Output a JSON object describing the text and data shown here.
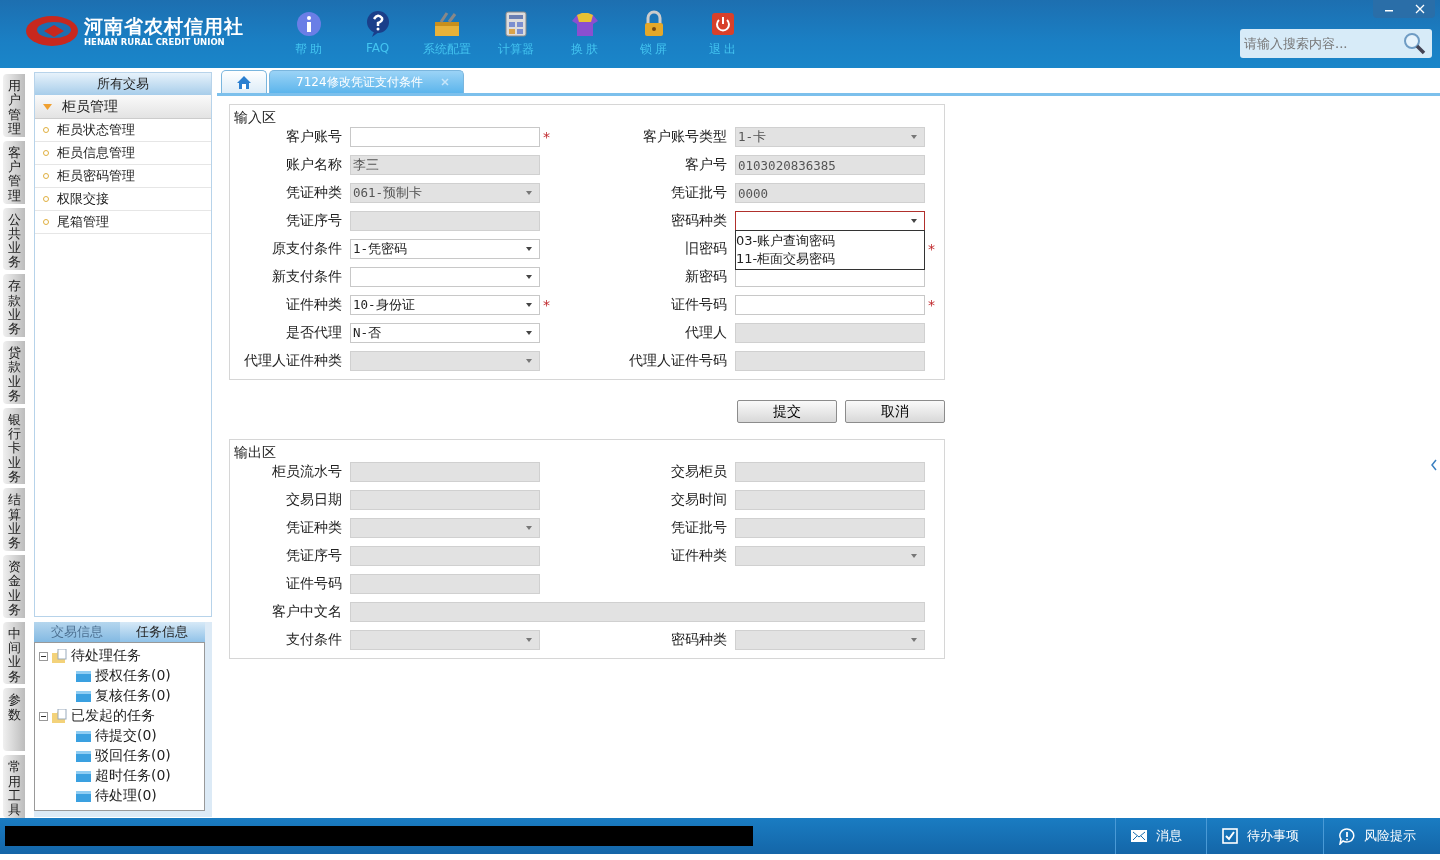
{
  "header": {
    "logo_title": "河南省农村信用社",
    "logo_subtitle": "HENAN RURAL CREDIT UNION",
    "tools": [
      {
        "kind": "help",
        "label": "帮 助"
      },
      {
        "kind": "faq",
        "label": "FAQ"
      },
      {
        "kind": "config",
        "label": "系统配置"
      },
      {
        "kind": "calculator",
        "label": "计算器"
      },
      {
        "kind": "skin",
        "label": "换 肤"
      },
      {
        "kind": "lock",
        "label": "锁 屏"
      },
      {
        "kind": "exit",
        "label": "退 出"
      }
    ],
    "search": {
      "placeholder": "请输入搜索内容..."
    }
  },
  "side_tabs": [
    "用户管理",
    "客户管理",
    "公共业务",
    "存款业务",
    "贷款业务",
    "银行卡业务",
    "结算业务",
    "资金业务",
    "中间业务",
    "参数",
    "常用工具"
  ],
  "sidebar": {
    "title": "所有交易",
    "group": {
      "label": "柜员管理",
      "expanded": true,
      "items": [
        "柜员状态管理",
        "柜员信息管理",
        "柜员密码管理",
        "权限交接",
        "尾箱管理"
      ]
    }
  },
  "task_panel": {
    "tabs": [
      {
        "label": "交易信息",
        "selected": false
      },
      {
        "label": "任务信息",
        "selected": true
      }
    ],
    "tree": [
      {
        "label": "待处理任务",
        "expanded": true,
        "children": [
          {
            "label": "授权任务(0)"
          },
          {
            "label": "复核任务(0)"
          }
        ]
      },
      {
        "label": "已发起的任务",
        "expanded": true,
        "children": [
          {
            "label": "待提交(0)"
          },
          {
            "label": "驳回任务(0)"
          },
          {
            "label": "超时任务(0)"
          },
          {
            "label": "待处理(0)"
          }
        ]
      }
    ]
  },
  "tabs": [
    {
      "kind": "home",
      "selected": false
    },
    {
      "kind": "page",
      "label": "7124修改凭证支付条件",
      "selected": true
    }
  ],
  "input_section": {
    "title": "输入区",
    "fields": [
      {
        "label": "客户账号",
        "kind": "text",
        "disabled": false,
        "mark": "*"
      },
      {
        "label": "客户账号类型",
        "kind": "select",
        "value": "1-卡",
        "disabled": true
      },
      {
        "label": "账户名称",
        "kind": "text",
        "value": "李三",
        "disabled": true
      },
      {
        "label": "客户号",
        "kind": "text",
        "value": "0103020836385",
        "disabled": true
      },
      {
        "label": "凭证种类",
        "kind": "select",
        "value": "061-预制卡",
        "disabled": true
      },
      {
        "label": "凭证批号",
        "kind": "text",
        "value": "0000",
        "disabled": true
      },
      {
        "label": "凭证序号",
        "kind": "text",
        "disabled": true
      },
      {
        "label": "密码种类",
        "kind": "select",
        "disabled": false,
        "expanded": true,
        "options": [
          "03-账户查询密码",
          "11-柜面交易密码"
        ]
      },
      {
        "label": "原支付条件",
        "kind": "select",
        "value": "1-凭密码",
        "disabled": false
      },
      {
        "label": "旧密码",
        "kind": "covered",
        "mark": "*"
      },
      {
        "label": "新支付条件",
        "kind": "select",
        "disabled": false
      },
      {
        "label": "新密码",
        "kind": "text",
        "disabled": false
      },
      {
        "label": "证件种类",
        "kind": "select",
        "value": "10-身份证",
        "disabled": false,
        "mark": "*"
      },
      {
        "label": "证件号码",
        "kind": "text",
        "disabled": false,
        "mark": "*"
      },
      {
        "label": "是否代理",
        "kind": "select",
        "value": "N-否",
        "disabled": false
      },
      {
        "label": "代理人",
        "kind": "text",
        "disabled": true
      },
      {
        "label": "代理人证件种类",
        "kind": "select",
        "disabled": true
      },
      {
        "label": "代理人证件号码",
        "kind": "text",
        "disabled": true
      }
    ]
  },
  "buttons": [
    "提交",
    "取消"
  ],
  "output_section": {
    "title": "输出区",
    "fields": [
      {
        "label": "柜员流水号",
        "kind": "text",
        "disabled": true
      },
      {
        "label": "交易柜员",
        "kind": "text",
        "disabled": true
      },
      {
        "label": "交易日期",
        "kind": "text",
        "disabled": true
      },
      {
        "label": "交易时间",
        "kind": "text",
        "disabled": true
      },
      {
        "label": "凭证种类",
        "kind": "select",
        "disabled": true
      },
      {
        "label": "凭证批号",
        "kind": "text",
        "disabled": true
      },
      {
        "label": "凭证序号",
        "kind": "text",
        "disabled": true
      },
      {
        "label": "证件种类",
        "kind": "select",
        "disabled": true
      },
      {
        "label": "证件号码",
        "kind": "text",
        "disabled": true
      },
      {
        "label": "客户中文名",
        "kind": "wide",
        "disabled": true
      },
      {
        "label": "支付条件",
        "kind": "select",
        "disabled": true
      },
      {
        "label": "密码种类",
        "kind": "select",
        "disabled": true
      }
    ]
  },
  "status_bar": {
    "items": [
      {
        "kind": "message",
        "label": "消息"
      },
      {
        "kind": "todo",
        "label": "待办事项"
      },
      {
        "kind": "risk",
        "label": "风险提示"
      }
    ]
  }
}
